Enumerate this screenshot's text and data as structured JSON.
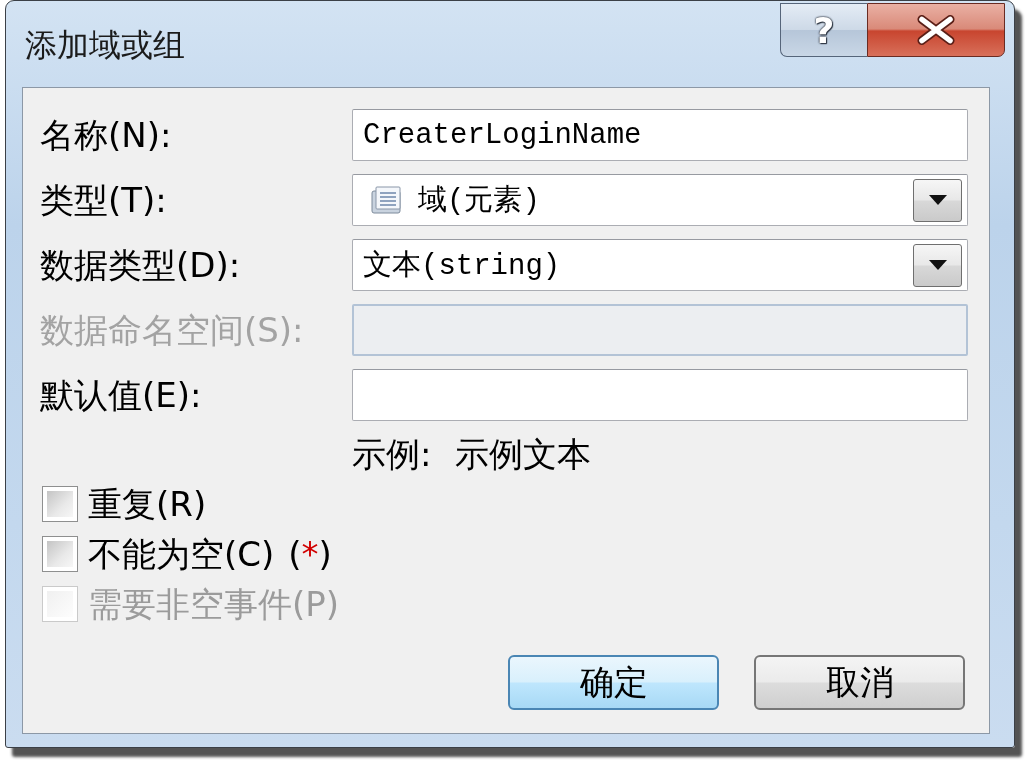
{
  "window": {
    "title": "添加域或组",
    "help_button": "?"
  },
  "fields": [
    {
      "kind": "text",
      "label": "名称(N):",
      "value": "CreaterLoginName",
      "disabled": false
    },
    {
      "kind": "combo",
      "label": "类型(T):",
      "value": "域(元素)",
      "show_icon": true,
      "disabled": false
    },
    {
      "kind": "combo",
      "label": "数据类型(D):",
      "value": "文本(string)",
      "show_icon": false,
      "disabled": false
    },
    {
      "kind": "text",
      "label": "数据命名空间(S):",
      "disabled": true
    },
    {
      "kind": "text",
      "label": "默认值(E):",
      "disabled": false
    }
  ],
  "example": {
    "label": "示例:",
    "text": "示例文本"
  },
  "checkboxes": [
    {
      "label": "重复(R)",
      "checked": false,
      "disabled": false
    },
    {
      "label": "不能为空(C)",
      "checked": false,
      "disabled": false,
      "note": {
        "open": "(",
        "mark": "*",
        "close": ")"
      }
    },
    {
      "label": "需要非空事件(P)",
      "checked": false,
      "disabled": true
    }
  ],
  "buttons": [
    {
      "label": "确定",
      "default": true
    },
    {
      "label": "取消",
      "default": false
    }
  ]
}
